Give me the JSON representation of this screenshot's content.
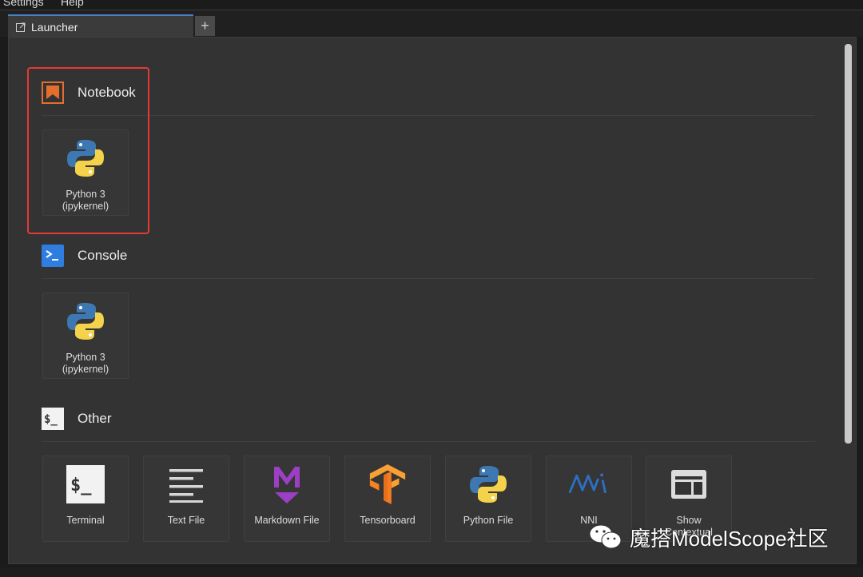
{
  "menubar": {
    "items": [
      "Settings",
      "Help"
    ]
  },
  "tab": {
    "label": "Launcher",
    "add_label": "+"
  },
  "sections": {
    "notebook": {
      "title": "Notebook",
      "cards": [
        {
          "line1": "Python 3",
          "line2": "(ipykernel)"
        }
      ]
    },
    "console": {
      "title": "Console",
      "cards": [
        {
          "line1": "Python 3",
          "line2": "(ipykernel)"
        }
      ]
    },
    "other": {
      "title": "Other",
      "cards": [
        {
          "line1": "Terminal",
          "icon": "terminal-icon"
        },
        {
          "line1": "Text File",
          "icon": "text-file-icon"
        },
        {
          "line1": "Markdown File",
          "icon": "markdown-icon"
        },
        {
          "line1": "Tensorboard",
          "icon": "tensorflow-icon"
        },
        {
          "line1": "Python File",
          "icon": "python-icon"
        },
        {
          "line1": "NNI",
          "icon": "nni-icon"
        },
        {
          "line1": "Show",
          "line2": "Contextual",
          "icon": "contextual-help-icon"
        }
      ]
    }
  },
  "watermark": {
    "text": "魔搭ModelScope社区"
  },
  "colors": {
    "accent": "#4a7fc1",
    "highlight": "#e53935",
    "notebook": "#e46e2e",
    "console": "#2f7de1",
    "markdown": "#9c3fc4"
  }
}
